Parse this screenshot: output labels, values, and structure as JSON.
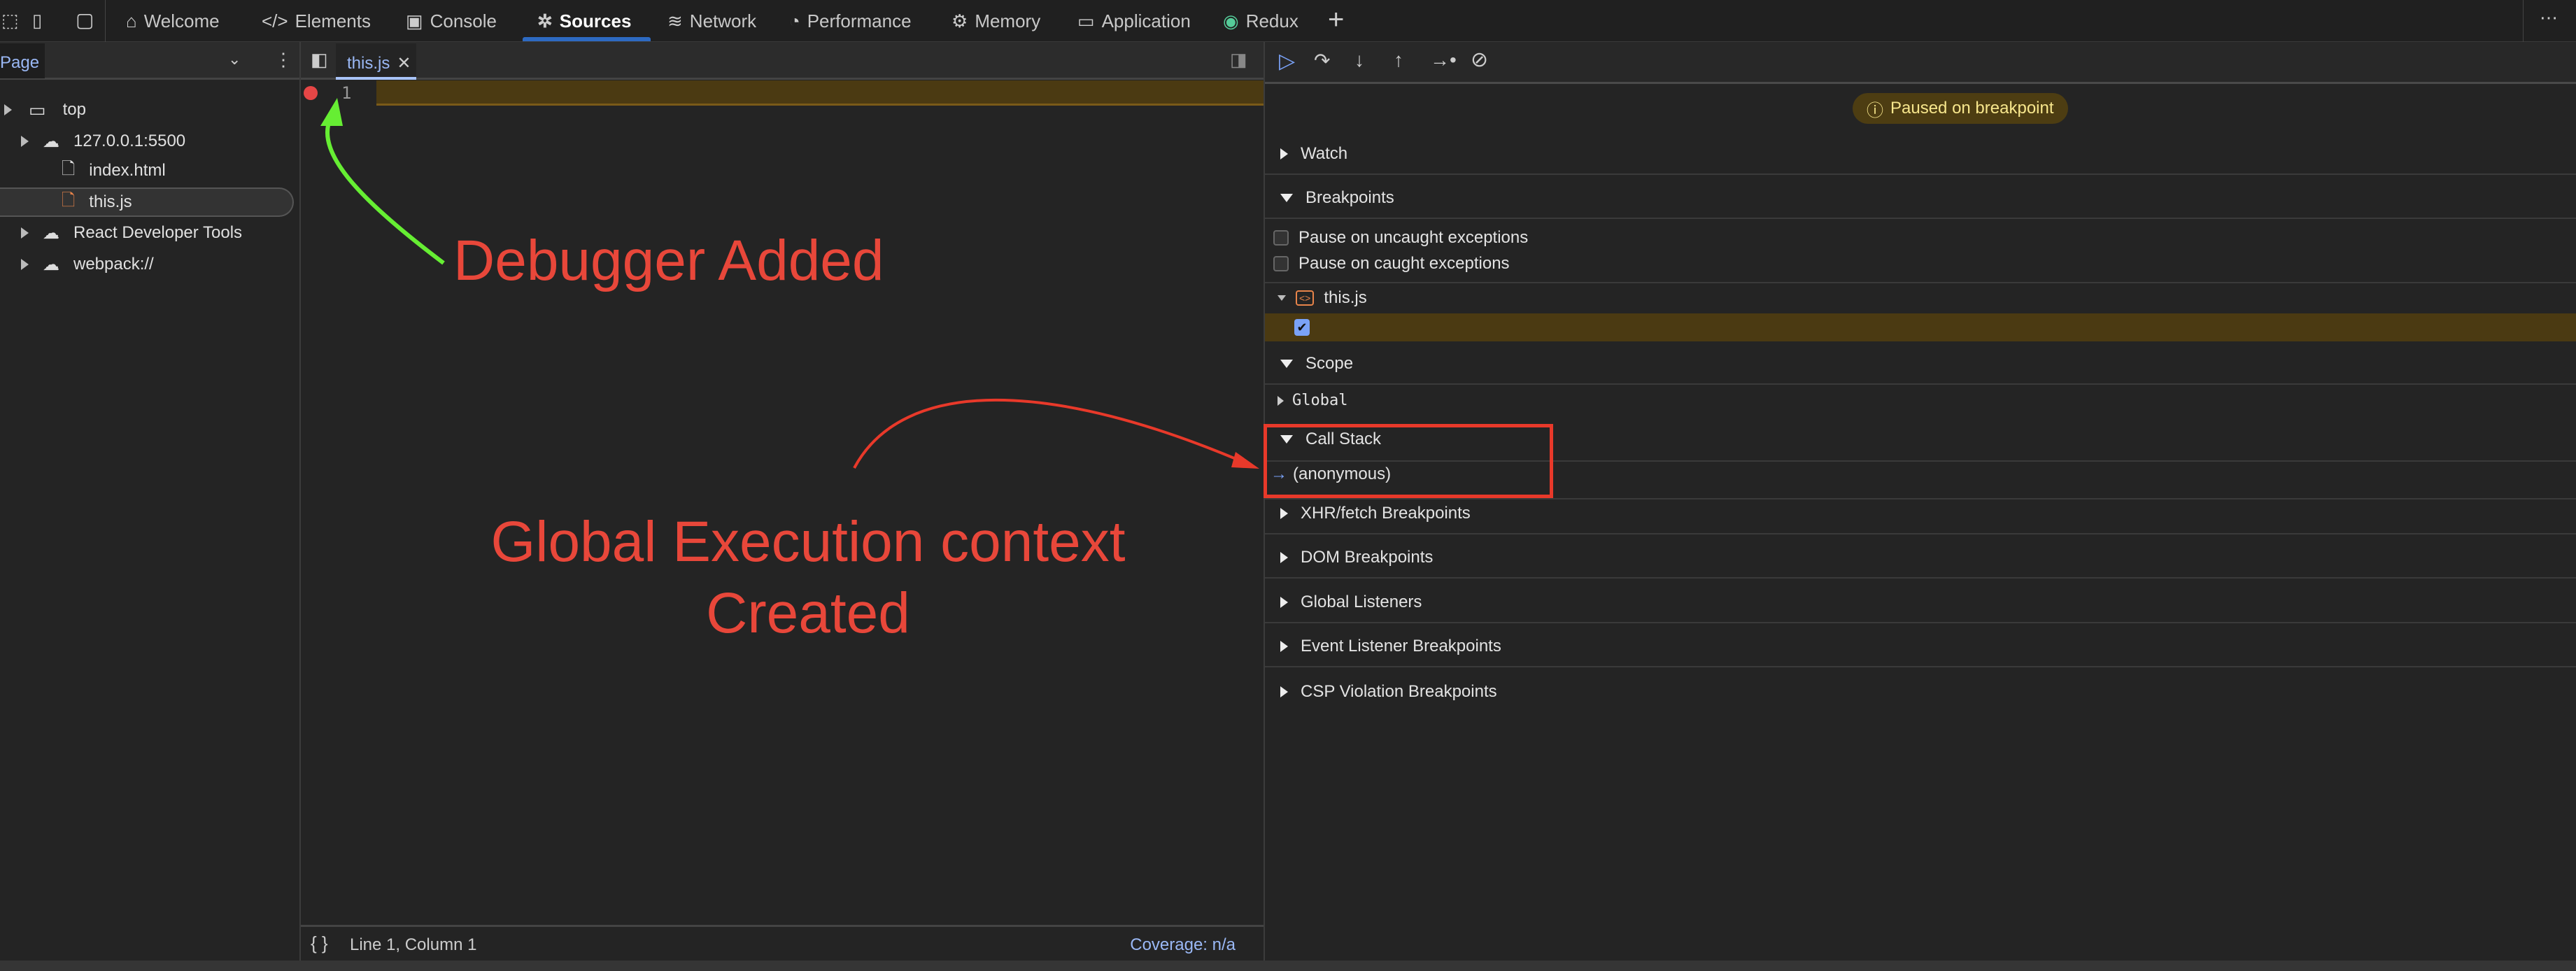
{
  "toolbar": {
    "tabs": [
      {
        "label": "Welcome",
        "icon": "home-icon"
      },
      {
        "label": "Elements",
        "icon": "code-icon"
      },
      {
        "label": "Console",
        "icon": "console-icon"
      },
      {
        "label": "Sources",
        "icon": "bug-icon",
        "active": true
      },
      {
        "label": "Network",
        "icon": "wifi-icon"
      },
      {
        "label": "Performance",
        "icon": "gauge-icon"
      },
      {
        "label": "Memory",
        "icon": "chip-icon"
      },
      {
        "label": "Application",
        "icon": "window-icon"
      },
      {
        "label": "Redux",
        "icon": "redux-icon"
      }
    ],
    "accent": "#2d6ac2"
  },
  "navigator": {
    "tab": "Page",
    "tree": [
      "top",
      "127.0.0.1:5500",
      "index.html",
      "this.js",
      "React Developer Tools",
      "webpack://"
    ]
  },
  "editor": {
    "tab": "this.js",
    "line_number": "1",
    "status": "Line 1, Column 1",
    "coverage": "Coverage: n/a"
  },
  "debugger": {
    "paused": "Paused on breakpoint",
    "watch": "Watch",
    "breakpoints": "Breakpoints",
    "pause_uncaught": "Pause on uncaught exceptions",
    "pause_caught": "Pause on caught exceptions",
    "bp_file": "this.js",
    "scope": "Scope",
    "global": "Global",
    "call_stack": "Call Stack",
    "frame": "(anonymous)",
    "sections": [
      "XHR/fetch Breakpoints",
      "DOM Breakpoints",
      "Global Listeners",
      "Event Listener Breakpoints",
      "CSP Violation Breakpoints"
    ]
  },
  "annotations": {
    "debugger_added": "Debugger Added",
    "gec_line1": "Global Execution context",
    "gec_line2": "Created",
    "colors": {
      "red": "#e8473a",
      "green": "#66ee33"
    }
  }
}
